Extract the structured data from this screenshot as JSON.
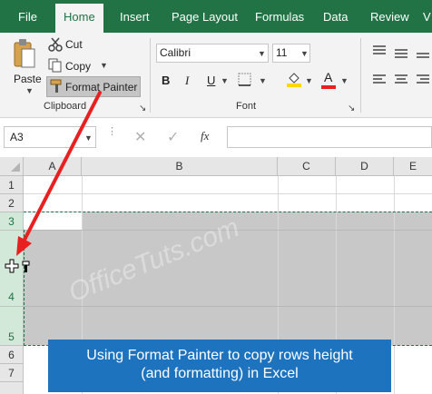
{
  "tabs": [
    "File",
    "Home",
    "Insert",
    "Page Layout",
    "Formulas",
    "Data",
    "Review",
    "V"
  ],
  "clipboard": {
    "paste_label": "Paste",
    "cut_label": "Cut",
    "copy_label": "Copy",
    "format_painter_label": "Format Painter",
    "group_label": "Clipboard"
  },
  "font": {
    "name": "Calibri",
    "size": "11",
    "group_label": "Font",
    "bold": "B",
    "italic": "I",
    "underline": "U",
    "font_color_letter": "A"
  },
  "formula_bar": {
    "name_box": "A3",
    "fx": "fx",
    "formula": ""
  },
  "columns": [
    "A",
    "B",
    "C",
    "D",
    "E"
  ],
  "rows": [
    "1",
    "2",
    "3",
    "4",
    "5",
    "6",
    "7"
  ],
  "watermark": "OfficeTuts.com",
  "callout": {
    "line1": "Using Format Painter to copy rows height",
    "line2": "(and formatting) in Excel"
  },
  "colors": {
    "ribbon_green": "#217346",
    "callout_blue": "#1e73be",
    "arrow_red": "#e8201f",
    "selection_fill": "#c8c8c8"
  },
  "icons": [
    "paste-icon",
    "cut-icon",
    "copy-icon",
    "format-painter-icon",
    "fill-color-icon",
    "font-color-icon",
    "cancel-icon",
    "enter-icon",
    "paintbrush-cursor-icon"
  ]
}
